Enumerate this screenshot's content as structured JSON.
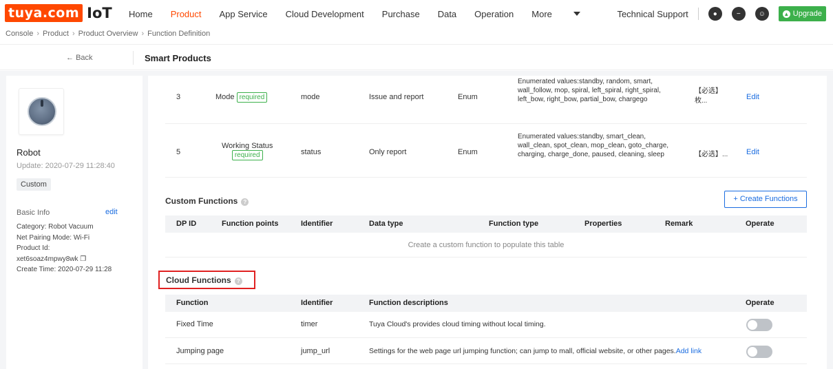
{
  "logo": {
    "brand": "tuya.com",
    "product": "IoT"
  },
  "nav": {
    "items": [
      "Home",
      "Product",
      "App Service",
      "Cloud Development",
      "Purchase",
      "Data",
      "Operation",
      "More"
    ],
    "active": "Product"
  },
  "tools": {
    "technical_support": "Technical Support",
    "upgrade": "Upgrade"
  },
  "breadcrumb": [
    "Console",
    "Product",
    "Product Overview",
    "Function Definition"
  ],
  "subheader": {
    "back": "Back",
    "title": "Smart Products"
  },
  "sidebar": {
    "name": "Robot",
    "update": "Update: 2020-07-29 11:28:40",
    "tag": "Custom",
    "basic_info": "Basic Info",
    "edit": "edit",
    "category": "Category: Robot Vacuum",
    "net_pairing": "Net Pairing Mode: Wi-Fi",
    "product_id_label": "Product Id:",
    "product_id": "xet6soaz4mpwy8wk",
    "create_time": "Create Time: 2020-07-29 11:28"
  },
  "standard_rows": [
    {
      "dp": "3",
      "name": "Mode",
      "required": "required",
      "identifier": "mode",
      "type": "Issue and report",
      "data": "Enum",
      "props": "Enumerated values:standby, random, smart, wall_follow, mop, spiral, left_spiral, right_spiral, left_bow, right_bow, partial_bow, chargego",
      "remark": "【必选】枚...",
      "op": "Edit"
    },
    {
      "dp": "5",
      "name": "Working Status",
      "required": "required",
      "identifier": "status",
      "type": "Only report",
      "data": "Enum",
      "props": "Enumerated values:standby, smart_clean, wall_clean, spot_clean, mop_clean, goto_charge, charging, charge_done, paused, cleaning, sleep",
      "remark": "【必选】...",
      "op": "Edit"
    }
  ],
  "custom": {
    "title": "Custom Functions",
    "create": "+ Create Functions",
    "headers": [
      "DP ID",
      "Function points",
      "Identifier",
      "Data type",
      "Function type",
      "Properties",
      "Remark",
      "Operate"
    ],
    "empty": "Create a custom function to populate this table"
  },
  "cloud": {
    "title": "Cloud Functions",
    "headers": [
      "Function",
      "Identifier",
      "Function descriptions",
      "Operate"
    ],
    "rows": [
      {
        "function": "Fixed Time",
        "identifier": "timer",
        "desc": "Tuya Cloud's provides cloud timing without local timing.",
        "link": "",
        "enabled": false
      },
      {
        "function": "Jumping page",
        "identifier": "jump_url",
        "desc": "Settings for the web page url jumping function; can jump to mall, official website, or other pages.",
        "link": "Add link",
        "enabled": false
      }
    ]
  },
  "colors": {
    "brand": "#ff4800",
    "link": "#1a6ce0",
    "success": "#3cb04b",
    "highlight": "#e02020"
  }
}
